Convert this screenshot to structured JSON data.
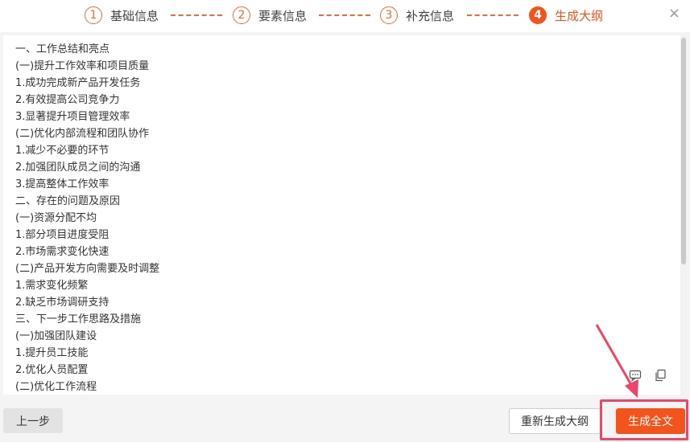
{
  "stepper": {
    "steps": [
      {
        "num": "1",
        "label": "基础信息"
      },
      {
        "num": "2",
        "label": "要素信息"
      },
      {
        "num": "3",
        "label": "补充信息"
      },
      {
        "num": "4",
        "label": "生成大纲"
      }
    ],
    "active_step": 4,
    "close_label": "×"
  },
  "outline": {
    "lines": [
      "一、工作总结和亮点",
      "(一)提升工作效率和项目质量",
      "1.成功完成新产品开发任务",
      "2.有效提高公司竞争力",
      "3.显著提升项目管理效率",
      "(二)优化内部流程和团队协作",
      "1.减少不必要的环节",
      "2.加强团队成员之间的沟通",
      "3.提高整体工作效率",
      "二、存在的问题及原因",
      "(一)资源分配不均",
      "1.部分项目进度受阻",
      "2.市场需求变化快速",
      "(二)产品开发方向需要及时调整",
      "1.需求变化频繁",
      "2.缺乏市场调研支持",
      "三、下一步工作思路及措施",
      "(一)加强团队建设",
      "1.提升员工技能",
      "2.优化人员配置",
      "(二)优化工作流程"
    ]
  },
  "footer": {
    "prev_label": "上一步",
    "regenerate_label": "重新生成大纲",
    "generate_full_label": "生成全文"
  },
  "colors": {
    "accent": "#f2541c",
    "annotation": "#ec4668"
  }
}
